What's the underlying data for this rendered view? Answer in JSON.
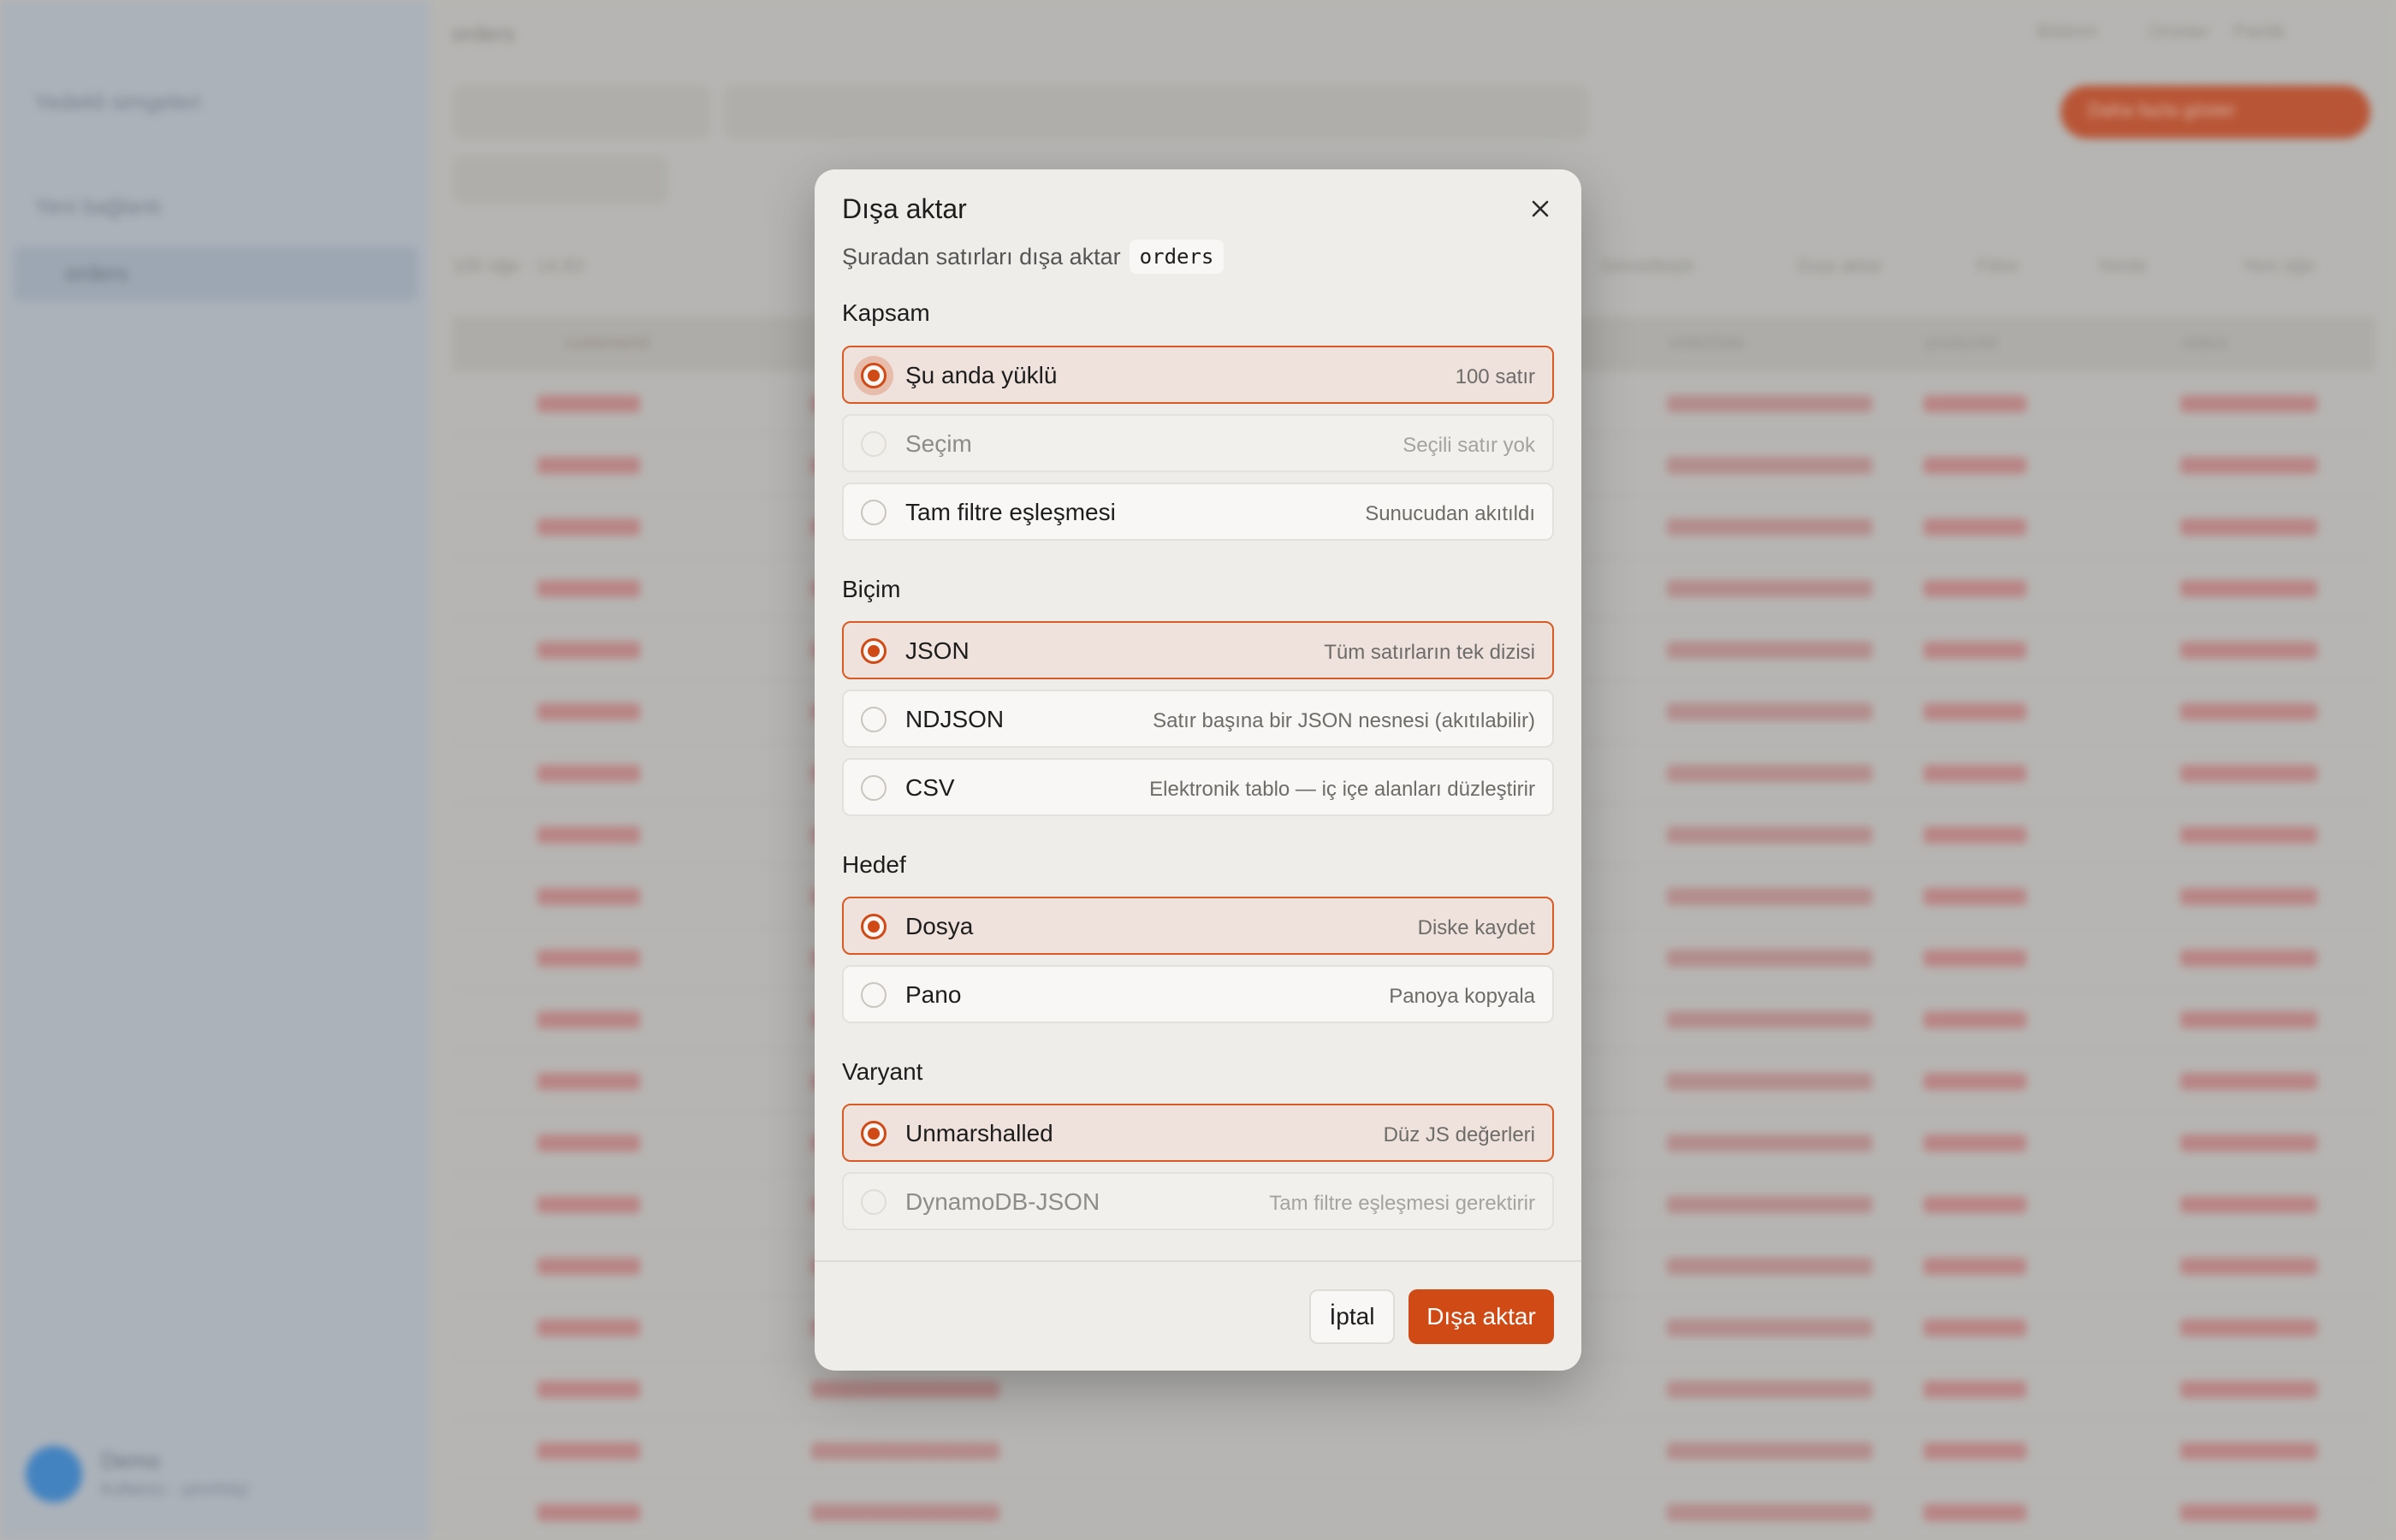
{
  "background": {
    "sidebar": {
      "items": [
        "Yedekli simgeleri",
        "Yeni bağlantı",
        "orders"
      ],
      "user_name": "Demo",
      "user_sub": "Kullanıcı · çevrimiçi"
    },
    "header": {
      "table_name": "orders",
      "links": [
        "Bildirim",
        "Ürünler",
        "Paritik"
      ],
      "primary_button": "Daha fazla göster"
    },
    "toolbar": {
      "count": "100 öğe · 14.83",
      "actions": [
        "Görselleştir",
        "Dışa aktar",
        "Filtre",
        "Yenile",
        "Yeni öğe"
      ]
    },
    "table": {
      "headers": [
        "customerId",
        "orderDate",
        "productId",
        "status"
      ]
    }
  },
  "modal": {
    "title": "Dışa aktar",
    "subtitle": "Şuradan satırları dışa aktar",
    "table_code": "orders",
    "sections": [
      {
        "title": "Kapsam",
        "options": [
          {
            "label": "Şu anda yüklü",
            "desc": "100 satır",
            "state": "selected"
          },
          {
            "label": "Seçim",
            "desc": "Seçili satır yok",
            "state": "disabled"
          },
          {
            "label": "Tam filtre eşleşmesi",
            "desc": "Sunucudan akıtıldı",
            "state": "normal"
          }
        ]
      },
      {
        "title": "Biçim",
        "options": [
          {
            "label": "JSON",
            "desc": "Tüm satırların tek dizisi",
            "state": "selected"
          },
          {
            "label": "NDJSON",
            "desc": "Satır başına bir JSON nesnesi (akıtılabilir)",
            "state": "normal"
          },
          {
            "label": "CSV",
            "desc": "Elektronik tablo — iç içe alanları düzleştirir",
            "state": "normal"
          }
        ]
      },
      {
        "title": "Hedef",
        "options": [
          {
            "label": "Dosya",
            "desc": "Diske kaydet",
            "state": "selected"
          },
          {
            "label": "Pano",
            "desc": "Panoya kopyala",
            "state": "normal"
          }
        ]
      },
      {
        "title": "Varyant",
        "options": [
          {
            "label": "Unmarshalled",
            "desc": "Düz JS değerleri",
            "state": "selected"
          },
          {
            "label": "DynamoDB-JSON",
            "desc": "Tam filtre eşleşmesi gerektirir",
            "state": "disabled"
          }
        ]
      }
    ],
    "cancel_label": "İptal",
    "export_label": "Dışa aktar"
  },
  "colors": {
    "accent": "#d04a16",
    "selected_bg": "#efe2dd",
    "modal_bg": "#efedea"
  },
  "icons": {
    "close": "close-icon"
  }
}
